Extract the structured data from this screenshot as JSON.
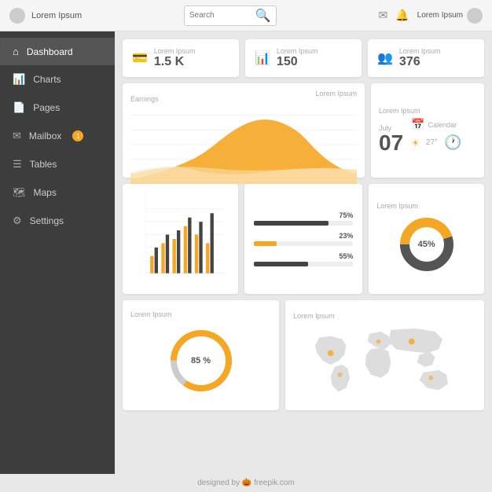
{
  "topbar": {
    "logo_text": "Lorem Ipsum",
    "search_placeholder": "Search",
    "user_name": "Lorem Ipsum"
  },
  "sidebar": {
    "items": [
      {
        "id": "dashboard",
        "label": "Dashboard",
        "icon": "⌂",
        "active": true,
        "badge": null
      },
      {
        "id": "charts",
        "label": "Charts",
        "icon": "📊",
        "active": false,
        "badge": null
      },
      {
        "id": "pages",
        "label": "Pages",
        "icon": "📄",
        "active": false,
        "badge": null
      },
      {
        "id": "mailbox",
        "label": "Mailbox",
        "icon": "✉",
        "active": false,
        "badge": "1"
      },
      {
        "id": "tables",
        "label": "Tables",
        "icon": "☰",
        "active": false,
        "badge": null
      },
      {
        "id": "maps",
        "label": "Maps",
        "icon": "🗺",
        "active": false,
        "badge": null
      },
      {
        "id": "settings",
        "label": "Settings",
        "icon": "⚙",
        "active": false,
        "badge": null
      }
    ]
  },
  "stats": [
    {
      "label": "Lorem Ipsum",
      "value": "1.5 K",
      "icon": "💳"
    },
    {
      "label": "Lorem Ipsum",
      "value": "150",
      "icon": "📊"
    },
    {
      "label": "Lorem Ipsum",
      "value": "376",
      "icon": "👥"
    }
  ],
  "earnings_label": "Earnings",
  "earnings_chart_label": "Lorem Ipsum",
  "date_card": {
    "month": "July",
    "day": "07",
    "calendar_label": "Calendar",
    "weather": "27°",
    "label": "Lorem Ipsum"
  },
  "bar_chart_label": "",
  "progress_card": {
    "items": [
      {
        "pct": "75%",
        "fill": "dark"
      },
      {
        "pct": "23%",
        "fill": "orange"
      },
      {
        "pct": "55%",
        "fill": "dark"
      }
    ]
  },
  "donut_small_label": "Lorem Ipsum",
  "donut_small_pct": "45%",
  "donut_large_label": "Lorem Ipsum",
  "donut_large_pct": "85 %",
  "map_label": "Lorem Ipsum",
  "footer_text": "designed by 🎃 freepik.com",
  "colors": {
    "orange": "#f5a623",
    "dark": "#444",
    "light_orange": "#f9d08e",
    "sidebar_bg": "#3d3d3d",
    "active_bg": "#555"
  }
}
